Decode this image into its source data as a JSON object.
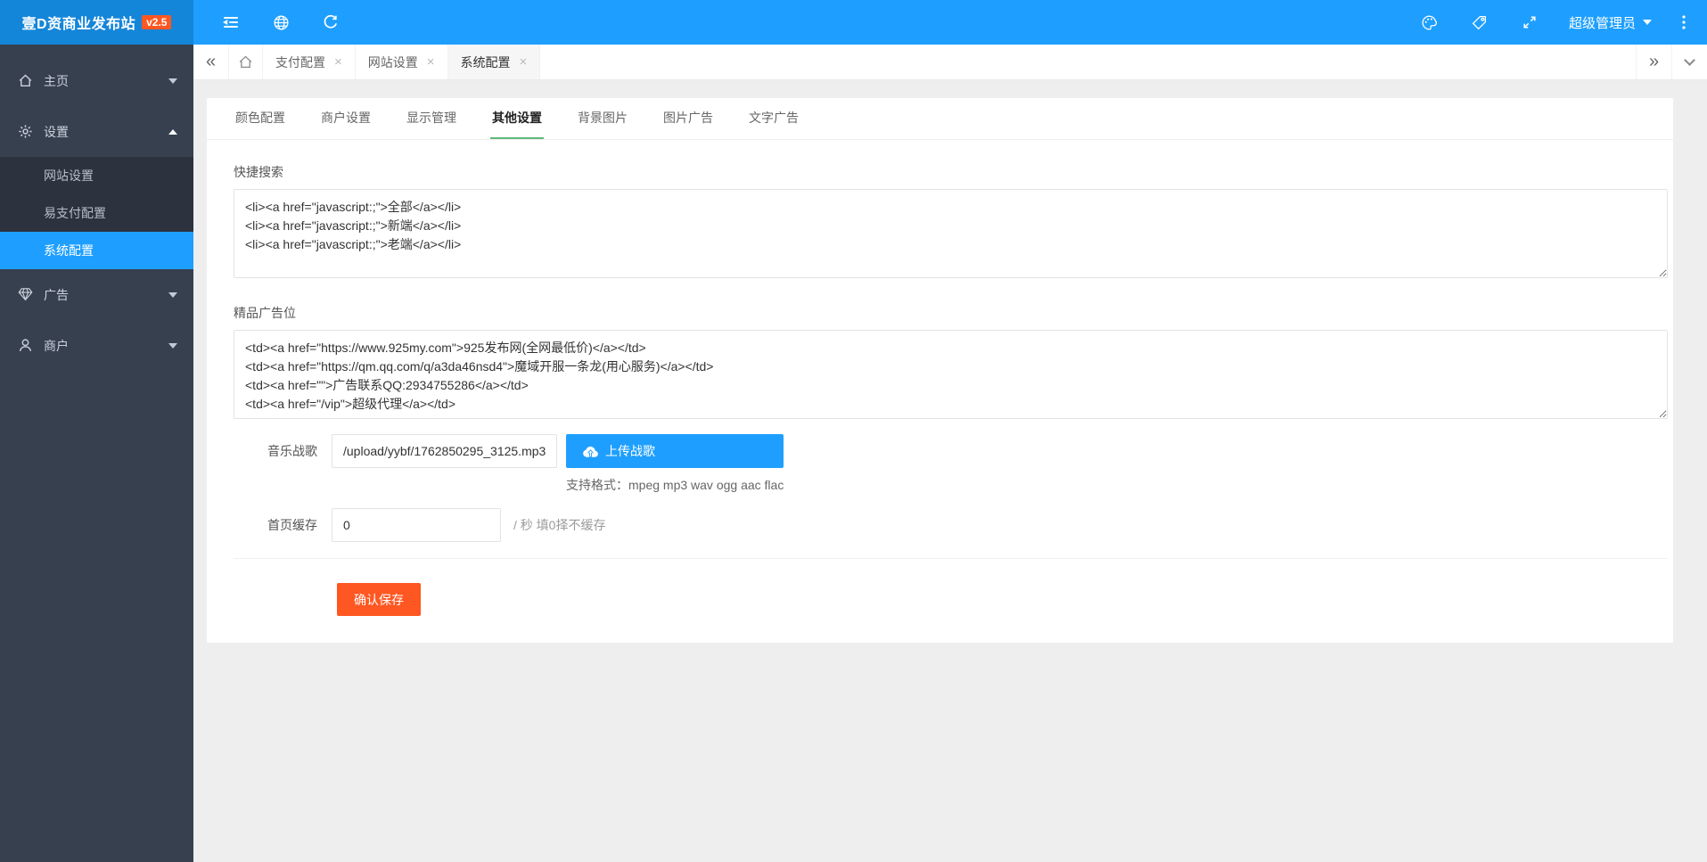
{
  "app": {
    "logo_text": "壹D资商业发布站",
    "version_badge": "v2.5",
    "colors": {
      "primary_blue": "#1E9FFF",
      "logo_blue": "#1486d9",
      "sidebar_dark": "#37404f",
      "submenu_dark": "#2c323e",
      "accent_green": "#5FB878",
      "warm_orange": "#FF5722",
      "content_bg": "#eeeeee"
    }
  },
  "topbar": {
    "left_icons": [
      "collapse-menu-icon",
      "globe-icon",
      "refresh-icon"
    ],
    "right_icons": [
      "palette-icon",
      "tag-icon",
      "fullscreen-icon",
      "more-vertical-icon"
    ],
    "user_name": "超级管理员"
  },
  "sidebar": {
    "items": [
      {
        "label": "主页",
        "icon": "home-icon",
        "caret": "down"
      },
      {
        "label": "设置",
        "icon": "gear-icon",
        "caret": "up",
        "expanded": true,
        "children": [
          {
            "label": "网站设置",
            "active": false
          },
          {
            "label": "易支付配置",
            "active": false
          },
          {
            "label": "系统配置",
            "active": true
          }
        ]
      },
      {
        "label": "广告",
        "icon": "diamond-icon",
        "caret": "down"
      },
      {
        "label": "商户",
        "icon": "user-icon",
        "caret": "down"
      }
    ]
  },
  "tabbar": {
    "tabs": [
      {
        "label": "支付配置",
        "close": "×",
        "active": false
      },
      {
        "label": "网站设置",
        "close": "×",
        "active": false
      },
      {
        "label": "系统配置",
        "close": "×",
        "active": true
      }
    ],
    "nav_left": "«",
    "nav_right": "»"
  },
  "content": {
    "tabs": [
      {
        "label": "颜色配置",
        "active": false
      },
      {
        "label": "商户设置",
        "active": false
      },
      {
        "label": "显示管理",
        "active": false
      },
      {
        "label": "其他设置",
        "active": true
      },
      {
        "label": "背景图片",
        "active": false
      },
      {
        "label": "图片广告",
        "active": false
      },
      {
        "label": "文字广告",
        "active": false
      }
    ],
    "form": {
      "quick_search": {
        "label": "快捷搜索",
        "value": "<li><a href=\"javascript:;\">全部</a></li>\n<li><a href=\"javascript:;\">新端</a></li>\n<li><a href=\"javascript:;\">老端</a></li>"
      },
      "premium_ads": {
        "label": "精品广告位",
        "value": "<td><a href=\"https://www.925my.com\">925发布网(全网最低价)</a></td>\n<td><a href=\"https://qm.qq.com/q/a3da46nsd4\">魔域开服一条龙(用心服务)</a></td>\n<td><a href=\"\">广告联系QQ:2934755286</a></td>\n<td><a href=\"/vip\">超级代理</a></td>"
      },
      "music": {
        "label": "音乐战歌",
        "value": "/upload/yybf/1762850295_3125.mp3",
        "upload_button": "上传战歌",
        "hint": "支持格式：mpeg mp3 wav ogg aac flac"
      },
      "cache": {
        "label": "首页缓存",
        "value": "0",
        "hint": "/ 秒 填0择不缓存"
      },
      "save_button": "确认保存"
    }
  }
}
